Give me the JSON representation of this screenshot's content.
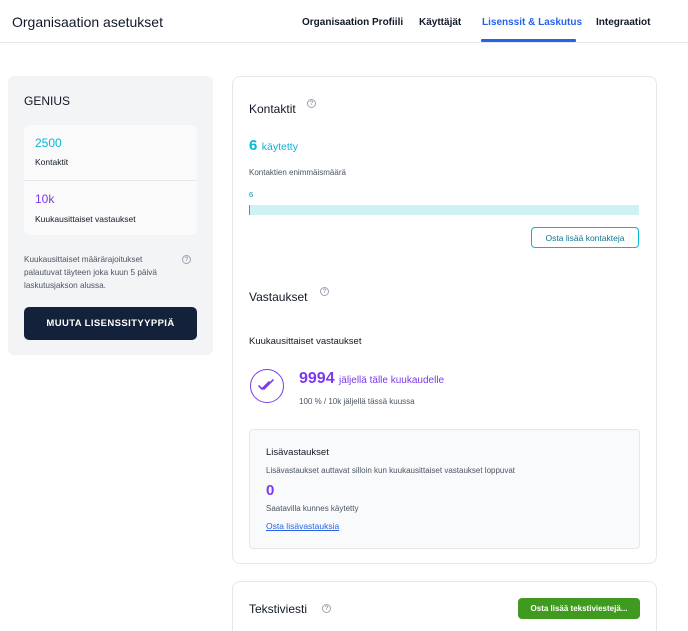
{
  "header": {
    "title": "Organisaation asetukset",
    "tabs": [
      {
        "label": "Organisaation Profiili",
        "active": false
      },
      {
        "label": "Käyttäjät",
        "active": false
      },
      {
        "label": "Lisenssit & Laskutus",
        "active": true
      },
      {
        "label": "Integraatiot",
        "active": false
      }
    ]
  },
  "sidebar": {
    "plan": "GENIUS",
    "stats": [
      {
        "value": "2500",
        "label": "Kontaktit"
      },
      {
        "value": "10k",
        "label": "Kuukausittaiset vastaukset"
      }
    ],
    "note": "Kuukausittaiset määrärajoitukset palautuvat täyteen joka kuun 5 päivä laskutusjakson alussa.",
    "help_icon": "?",
    "button": "MUUTA LISENSSITYYPPIÄ"
  },
  "contacts": {
    "title": "Kontaktit",
    "help_icon": "?",
    "used_count": "6",
    "used_label": "käytetty",
    "max_label": "Kontaktien enimmäismäärä",
    "max_value": "6",
    "progress_fraction": 0.003,
    "buy_button": "Osta lisää kontakteja"
  },
  "responses": {
    "title": "Vastaukset",
    "help_icon": "?",
    "monthly_title": "Kuukausittaiset vastaukset",
    "icon": "double-check-icon",
    "remaining": "9994",
    "remaining_label": "jäljellä tälle kuukaudelle",
    "remaining_sub": "100 % / 10k jäljellä tässä kuussa",
    "extra": {
      "title": "Lisävastaukset",
      "description": "Lisävastaukset auttavat silloin kun kuukausittaiset vastaukset loppuvat",
      "value": "0",
      "status": "Saatavilla kunnes käytetty",
      "link": "Osta lisävastauksia"
    }
  },
  "sms": {
    "title": "Tekstiviesti",
    "help_icon": "?",
    "buy_button": "Osta lisää tekstiviestejä..."
  },
  "colors": {
    "accent_blue": "#2563eb",
    "cyan": "#06b6d4",
    "purple": "#7c3aed",
    "navy": "#13213a",
    "green": "#3f9a1f"
  }
}
